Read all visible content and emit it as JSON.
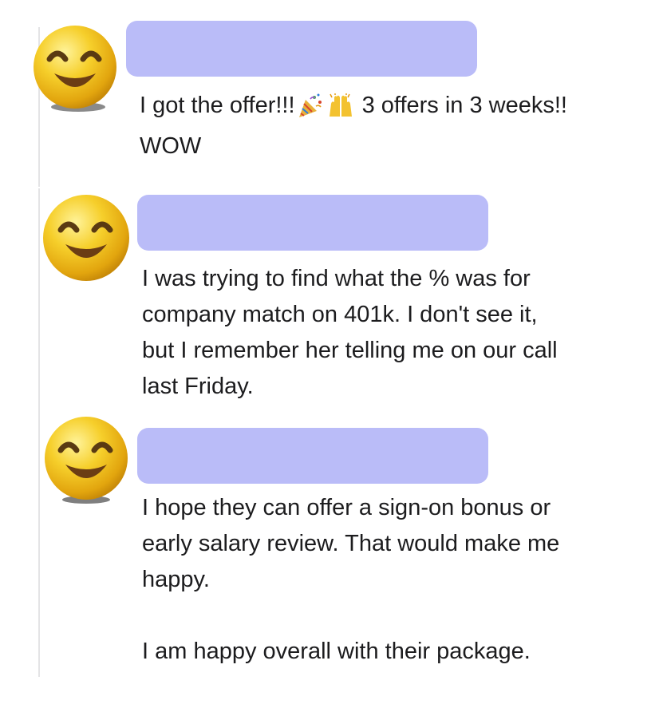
{
  "messages": [
    {
      "author_redacted": true,
      "avatar_icon": "smiling-face-emoji",
      "text_before_emoji": "I got the offer!!!",
      "emojis": [
        "party-popper-icon",
        "raising-hands-icon"
      ],
      "text_after_emoji": " 3 offers in 3 weeks!!\nWOW"
    },
    {
      "author_redacted": true,
      "avatar_icon": "smiling-face-emoji",
      "text": "I was trying to find what the % was for\ncompany match on 401k. I don't see it,\nbut I remember her telling me on our call\nlast Friday."
    },
    {
      "author_redacted": true,
      "avatar_icon": "smiling-face-emoji",
      "text": "I hope they can offer a sign-on bonus or\nearly salary review. That would make me\nhappy.\n\nI am happy overall with their package."
    }
  ],
  "colors": {
    "redaction": "#babcf8",
    "text": "#1c1c1e",
    "thread_line": "#e4e4e6",
    "emoji_face": "#f4c81a"
  }
}
